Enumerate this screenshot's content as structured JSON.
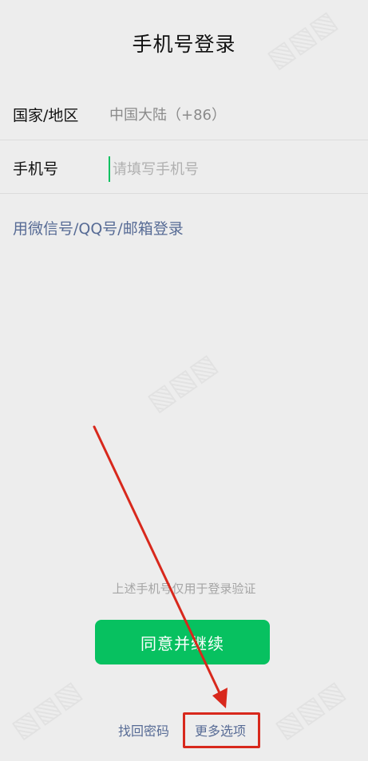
{
  "header": {
    "title": "手机号登录"
  },
  "form": {
    "country_label": "国家/地区",
    "country_value": "中国大陆（+86）",
    "phone_label": "手机号",
    "phone_placeholder": "请填写手机号",
    "phone_value": ""
  },
  "alt_login": {
    "label": "用微信号/QQ号/邮箱登录"
  },
  "footer": {
    "hint": "上述手机号仅用于登录验证",
    "continue_label": "同意并继续",
    "recover_password_label": "找回密码",
    "more_options_label": "更多选项"
  },
  "annotation": {
    "highlight_color": "#d8281c"
  },
  "colors": {
    "accent_green": "#07c160",
    "link_blue": "#576b95",
    "background": "#ededed"
  }
}
